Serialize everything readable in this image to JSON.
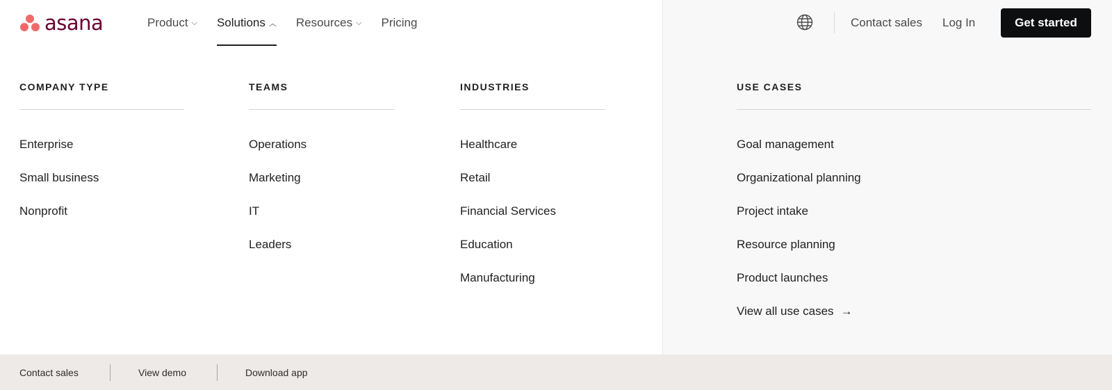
{
  "brand": {
    "name": "asana",
    "dot_color": "#f06a6a",
    "word_color": "#690031"
  },
  "nav": {
    "items": [
      {
        "label": "Product",
        "has_chevron": true,
        "chevron": "⌵",
        "active": false
      },
      {
        "label": "Solutions",
        "has_chevron": true,
        "chevron": "︿",
        "active": true
      },
      {
        "label": "Resources",
        "has_chevron": true,
        "chevron": "⌵",
        "active": false
      },
      {
        "label": "Pricing",
        "has_chevron": false,
        "active": false
      }
    ],
    "globe_icon": "globe-icon",
    "contact_sales": "Contact sales",
    "log_in": "Log In",
    "get_started": "Get started"
  },
  "menu": {
    "company_type": {
      "heading": "COMPANY TYPE",
      "items": [
        "Enterprise",
        "Small business",
        "Nonprofit"
      ]
    },
    "teams": {
      "heading": "TEAMS",
      "items": [
        "Operations",
        "Marketing",
        "IT",
        "Leaders"
      ]
    },
    "industries": {
      "heading": "INDUSTRIES",
      "items": [
        "Healthcare",
        "Retail",
        "Financial Services",
        "Education",
        "Manufacturing"
      ]
    },
    "use_cases": {
      "heading": "USE CASES",
      "items": [
        "Goal management",
        "Organizational planning",
        "Project intake",
        "Resource planning",
        "Product launches"
      ],
      "view_all": "View all use cases",
      "arrow": "→"
    }
  },
  "footer": {
    "contact_sales": "Contact sales",
    "view_demo": "View demo",
    "download_app": "Download app"
  },
  "colors": {
    "accent_dark": "#0d0e10",
    "right_panel_bg": "#f9f8f8",
    "footer_bg": "#edeae7"
  }
}
